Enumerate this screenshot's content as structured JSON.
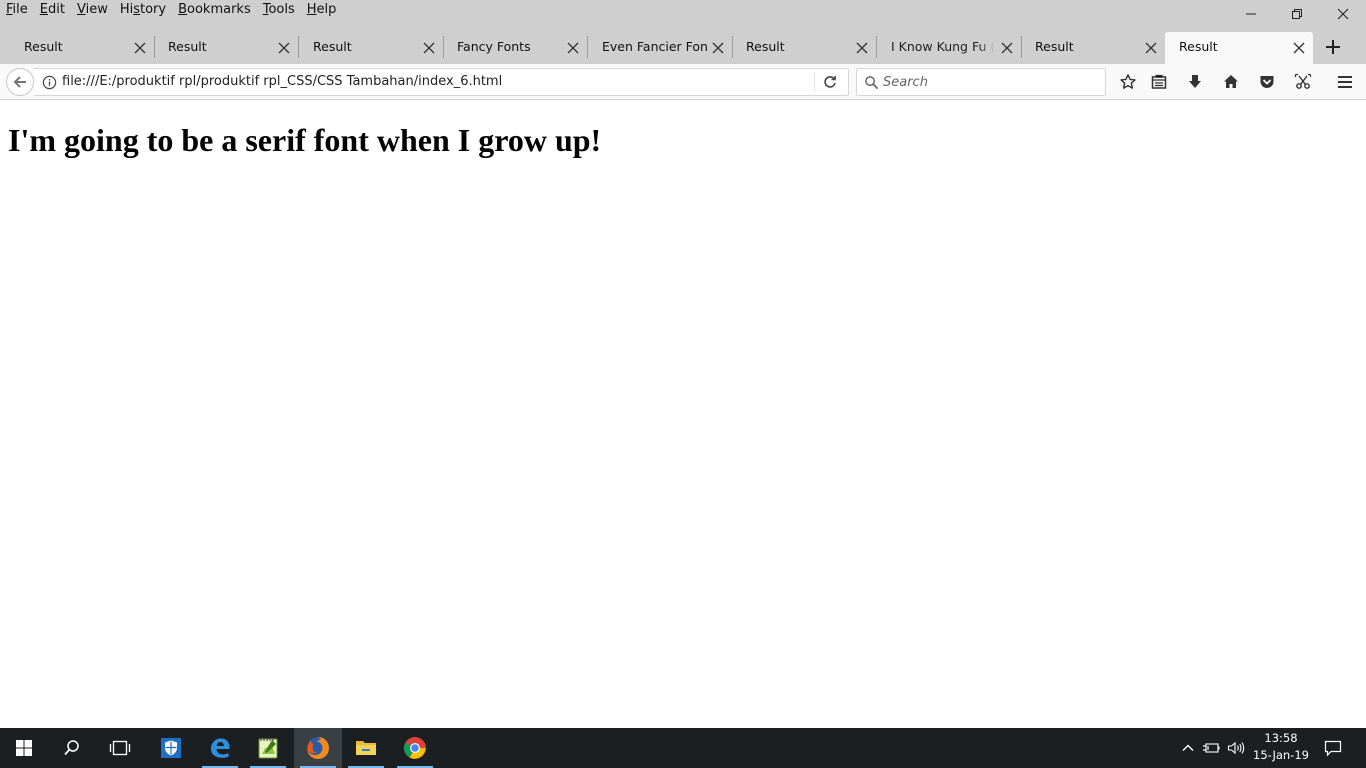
{
  "menubar": {
    "items": [
      "File",
      "Edit",
      "View",
      "History",
      "Bookmarks",
      "Tools",
      "Help"
    ]
  },
  "window_controls": [
    "minimize-icon",
    "restore-icon",
    "close-icon"
  ],
  "tabs": [
    {
      "title": "Result",
      "active": false
    },
    {
      "title": "Result",
      "active": false
    },
    {
      "title": "Result",
      "active": false
    },
    {
      "title": "Fancy Fonts",
      "active": false
    },
    {
      "title": "Even Fancier Fonts",
      "active": false
    },
    {
      "title": "Result",
      "active": false
    },
    {
      "title": "I Know Kung Fu (er,",
      "active": false
    },
    {
      "title": "Result",
      "active": false
    },
    {
      "title": "Result",
      "active": true
    }
  ],
  "navbar": {
    "url": "file:///E:/produktif rpl/produktif rpl_CSS/CSS Tambahan/index_6.html",
    "search_placeholder": "Search",
    "toolbar_icons": [
      "star-icon",
      "reading-list-icon",
      "download-icon",
      "home-icon",
      "pocket-icon",
      "screenshot-icon",
      "menu-icon"
    ]
  },
  "page": {
    "heading": "I'm going to be a serif font when I grow up!"
  },
  "taskbar": {
    "apps": [
      "windows-start-icon",
      "search-icon",
      "task-view-icon",
      "windows-defender-icon",
      "edge-icon",
      "notepad-plus-icon",
      "firefox-icon",
      "file-explorer-icon",
      "chrome-icon"
    ],
    "time": "13:58",
    "date": "15-Jan-19"
  },
  "colors": {
    "chrome_bg": "#cfcfcf",
    "toolbar_bg": "#f9f9f9",
    "taskbar_bg": "#1b1f22",
    "taskbar_accent": "#76b9ed"
  }
}
